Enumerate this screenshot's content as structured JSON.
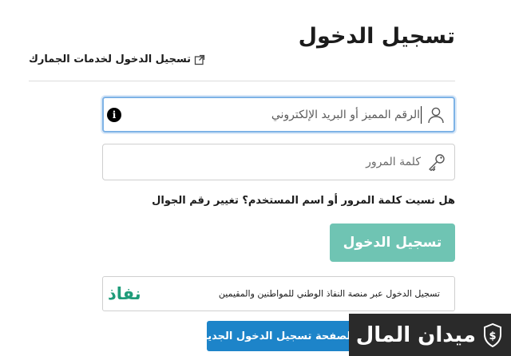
{
  "page": {
    "title": "تسجيل الدخول",
    "customs_link": "تسجيل الدخول لخدمات الجمارك"
  },
  "form": {
    "username": {
      "placeholder": "الرقم المميز أو البريد الإلكتروني",
      "icon": "user-icon",
      "info_glyph": "i"
    },
    "password": {
      "placeholder": "كلمة المرور",
      "icon": "key-icon"
    },
    "forgot_text": "هل نسيت كلمة المرور أو اسم المستخدم؟ تغيير رقم الجوال",
    "login_button": "تسجيل الدخول"
  },
  "nafath": {
    "description": "تسجيل الدخول عبر منصة النفاذ الوطني للمواطنين والمقيمين",
    "logo_text": "نفاذ"
  },
  "new_login_button": "العودة لصفحة تسجيل الدخول الجديدة",
  "watermark": {
    "text": "ميدان المال"
  },
  "colors": {
    "accent": "#1d84c9",
    "login_button": "#6fc4b3",
    "nafath_green": "#1f9c7a",
    "focus_border": "#7eb3e6"
  }
}
